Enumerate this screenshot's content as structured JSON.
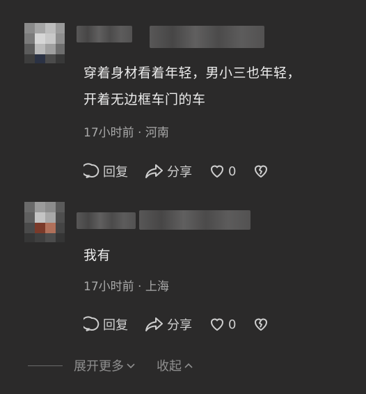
{
  "comments": [
    {
      "text_lines": [
        "穿着身材看着年轻，男小三也年轻，",
        "开着无边框车门的车"
      ],
      "meta": "17小时前 · 河南",
      "reply_label": "回复",
      "share_label": "分享",
      "like_count": "0"
    },
    {
      "text_lines": [
        "我有"
      ],
      "meta": "17小时前 · 上海",
      "reply_label": "回复",
      "share_label": "分享",
      "like_count": "0"
    }
  ],
  "footer": {
    "expand_label": "展开更多",
    "collapse_label": "收起"
  },
  "icons": {
    "reply": "speech-bubble-icon",
    "share": "share-arrow-icon",
    "like": "heart-icon",
    "dislike": "broken-heart-icon",
    "expand": "chevron-down-icon",
    "collapse": "chevron-up-icon"
  },
  "colors": {
    "background": "#2b2a2a",
    "text": "#ececec",
    "meta": "#a9a9a9",
    "footer": "#8f8f8f"
  }
}
